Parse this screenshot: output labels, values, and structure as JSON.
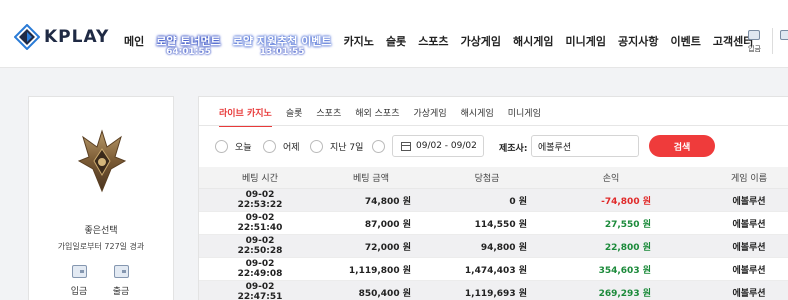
{
  "header": {
    "logo_text": "KPLAY",
    "nav": [
      {
        "label": "메인",
        "type": "normal"
      },
      {
        "label": "로얄 토너먼트",
        "sub": "64:01:55",
        "type": "event"
      },
      {
        "label": "로얄 지원추천 이벤트",
        "sub": "13:01:55",
        "type": "event2"
      },
      {
        "label": "카지노",
        "type": "normal"
      },
      {
        "label": "슬롯",
        "type": "normal"
      },
      {
        "label": "스포츠",
        "type": "normal"
      },
      {
        "label": "가상게임",
        "type": "normal"
      },
      {
        "label": "해시게임",
        "type": "normal"
      },
      {
        "label": "미니게임",
        "type": "normal"
      },
      {
        "label": "공지사항",
        "type": "normal"
      },
      {
        "label": "이벤트",
        "type": "normal"
      },
      {
        "label": "고객센터",
        "type": "normal"
      }
    ],
    "deposit_icon_label": "입금"
  },
  "profile": {
    "nickname": "좋은선택",
    "joined": "가입일로부터 727일 경과",
    "deposit_label": "입금",
    "withdraw_label": "출금"
  },
  "tabs": [
    "라이브 카지노",
    "슬롯",
    "스포츠",
    "해외 스포츠",
    "가상게임",
    "해시게임",
    "미니게임"
  ],
  "filters": {
    "today": "오늘",
    "yesterday": "어제",
    "last7": "지난 7일",
    "date_range": "09/02 - 09/02",
    "provider_label": "제조사:",
    "provider_value": "에볼루션",
    "search_label": "검색"
  },
  "table": {
    "headers": [
      "베팅 시간",
      "베팅 금액",
      "당첨금",
      "손익",
      "게임 이름"
    ],
    "rows": [
      {
        "time": "09-02 22:53:22",
        "bet": "74,800 원",
        "win": "0 원",
        "pl": "-74,800 원",
        "pl_sign": "neg",
        "game": "에볼루션"
      },
      {
        "time": "09-02 22:51:40",
        "bet": "87,000 원",
        "win": "114,550 원",
        "pl": "27,550 원",
        "pl_sign": "pos",
        "game": "에볼루션"
      },
      {
        "time": "09-02 22:50:28",
        "bet": "72,000 원",
        "win": "94,800 원",
        "pl": "22,800 원",
        "pl_sign": "pos",
        "game": "에볼루션"
      },
      {
        "time": "09-02 22:49:08",
        "bet": "1,119,800 원",
        "win": "1,474,403 원",
        "pl": "354,603 원",
        "pl_sign": "pos",
        "game": "에볼루션"
      },
      {
        "time": "09-02 22:47:51",
        "bet": "850,400 원",
        "win": "1,119,693 원",
        "pl": "269,293 원",
        "pl_sign": "pos",
        "game": "에볼루션"
      }
    ]
  },
  "colors": {
    "accent": "#ef3b3b",
    "negative": "#e02a2a",
    "positive": "#1b8a3a",
    "logo": "#1f2a44"
  }
}
